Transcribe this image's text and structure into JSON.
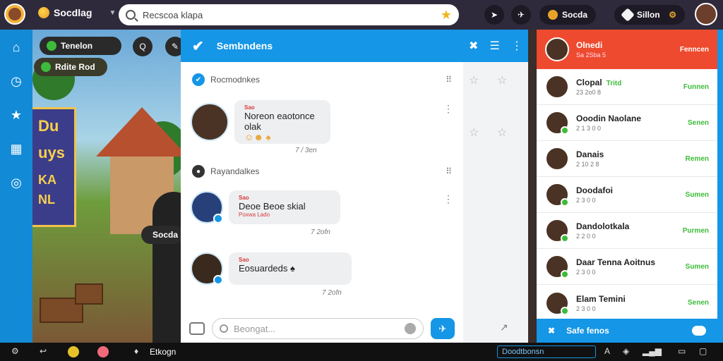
{
  "topbar": {
    "brand": "Socdlag",
    "search_text": "Recscoa klapa",
    "pill_coins": "Socda",
    "pill_gems": "Sillon"
  },
  "scene": {
    "sign_text": [
      "Du",
      "uys",
      "KA NL"
    ],
    "pill1_label": "Tenelon",
    "pill2_label": "Rdite Rod",
    "pill3_label": "Socda",
    "circle1": "Q"
  },
  "chat": {
    "title": "Sembndens",
    "section1": "Rocmodnkes",
    "section2": "Rayandalkes",
    "messages": [
      {
        "from": "Sao",
        "body": "Noreon eaotonce olak",
        "sub": "",
        "emoji": "☺☻ ♠",
        "time": "7 / 3en"
      },
      {
        "from": "Sao",
        "body": "Deoe Beoe skial",
        "sub": "Poxwa Lado",
        "emoji": "",
        "time": "7 2ofn"
      },
      {
        "from": "Sao",
        "body": "Eosuardeds ♠",
        "sub": "",
        "emoji": "",
        "time": "7 2ofn"
      }
    ],
    "input_placeholder": "Beongat..."
  },
  "friends": {
    "header": {
      "name": "Olnedi",
      "meta": "Sa 2Sba 5",
      "status": "Fenncen"
    },
    "rows": [
      {
        "name": "Clopal",
        "tag": "Tritd",
        "meta": "23 2o0 8",
        "status": "Funnen"
      },
      {
        "name": "Ooodin Naolane",
        "tag": "",
        "meta": "2 1 3 0 0",
        "status": "Senen"
      },
      {
        "name": "Danais",
        "tag": "",
        "meta": "2 10 2 8",
        "status": "Remen"
      },
      {
        "name": "Doodafoi",
        "tag": "",
        "meta": "2 3 0 0",
        "status": "Sumen"
      },
      {
        "name": "Dandolotkala",
        "tag": "",
        "meta": "2 2 0 0",
        "status": "Purmen"
      },
      {
        "name": "Daar Tenna Aoitnus",
        "tag": "",
        "meta": "2 3 0 0",
        "status": "Sumen"
      },
      {
        "name": "Elam Temini",
        "tag": "",
        "meta": "2 3 0 0",
        "status": "Senen"
      }
    ],
    "footer": "Safe fenos"
  },
  "taskbar": {
    "app": "Etkogn",
    "search": "Doodtbonsn"
  },
  "colors": {
    "accent_blue": "#1596e6",
    "header_red": "#ee4a2f",
    "online_green": "#3dbb3a"
  }
}
